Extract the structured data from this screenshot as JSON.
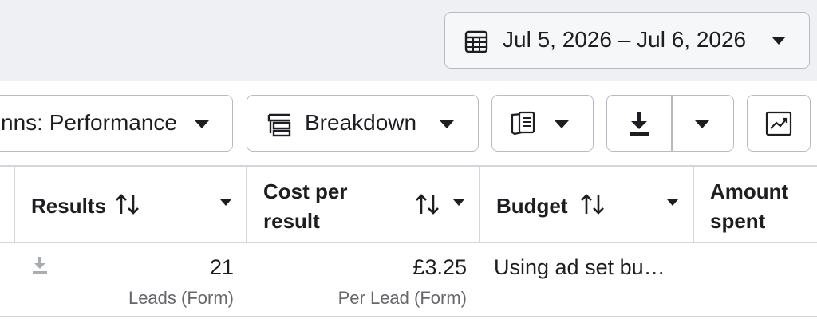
{
  "date_range": {
    "label": "Jul 5, 2026 – Jul 6, 2026",
    "icon": "calendar-icon"
  },
  "toolbar": {
    "columns_label": "nns: Performance",
    "breakdown_label": "Breakdown",
    "reports_icon": "reports-icon",
    "export_icon": "download-icon",
    "chart_icon": "chart-icon"
  },
  "table": {
    "headers": {
      "results": "Results",
      "cost_per_result_line1": "Cost per",
      "cost_per_result_line2": "result",
      "budget": "Budget",
      "amount_spent_line1": "Amount",
      "amount_spent_line2": "spent"
    },
    "row": {
      "results_value": "21",
      "results_sub": "Leads (Form)",
      "cost_value": "£3.25",
      "cost_sub": "Per Lead (Form)",
      "budget_value": "Using ad set bu…"
    }
  }
}
